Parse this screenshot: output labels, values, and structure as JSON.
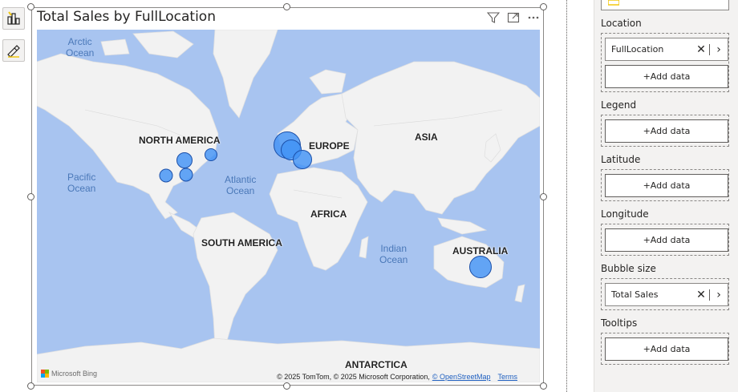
{
  "visual": {
    "title": "Total Sales by FullLocation",
    "header_icons": [
      "filter-icon",
      "focus-mode-icon",
      "more-options-icon"
    ]
  },
  "map": {
    "ocean_labels": [
      {
        "line1": "Arctic",
        "line2": "Ocean"
      },
      {
        "line1": "Pacific",
        "line2": "Ocean"
      },
      {
        "line1": "Atlantic",
        "line2": "Ocean"
      },
      {
        "line1": "Indian",
        "line2": "Ocean"
      }
    ],
    "continent_labels": [
      "NORTH AMERICA",
      "EUROPE",
      "ASIA",
      "AFRICA",
      "SOUTH AMERICA",
      "AUSTRALIA",
      "ANTARCTICA"
    ],
    "logo_text": "Microsoft Bing",
    "attribution": "© 2025 TomTom, © 2025 Microsoft Corporation,",
    "attribution_link": "© OpenStreetMap",
    "terms": "Terms",
    "bubble_color": "#4292f5"
  },
  "pane": {
    "sections": [
      {
        "label": "Location",
        "field": "FullLocation",
        "add": "+Add data"
      },
      {
        "label": "Legend",
        "add": "+Add data"
      },
      {
        "label": "Latitude",
        "add": "+Add data"
      },
      {
        "label": "Longitude",
        "add": "+Add data"
      },
      {
        "label": "Bubble size",
        "field": "Total Sales"
      },
      {
        "label": "Tooltips",
        "add": "+Add data"
      }
    ]
  },
  "colors": {
    "ocean": "#a8c4f0",
    "land": "#f2f2f2",
    "pane_bg": "#f3f2f1",
    "accent": "#f2c811"
  }
}
